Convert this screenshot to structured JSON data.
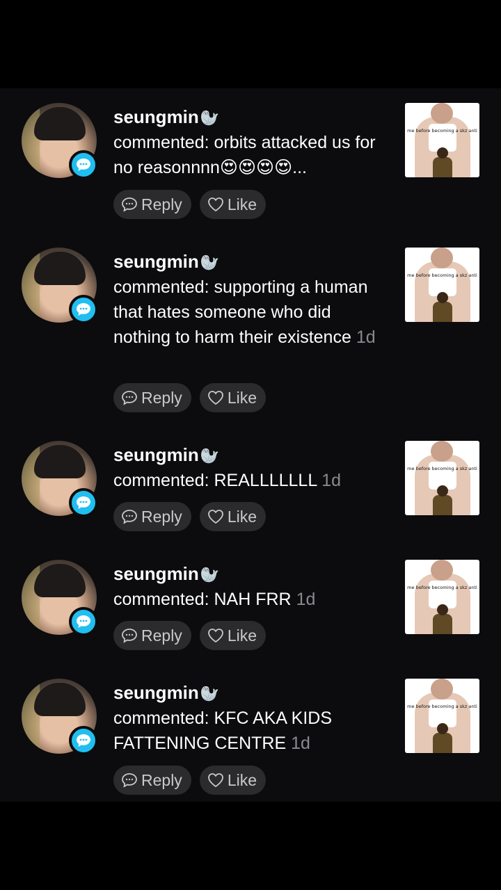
{
  "comments": [
    {
      "username": "seungmin",
      "username_emoji": "🦭",
      "text": "commented: orbits attacked us for no reasonnnn😍😍😍😍...",
      "time": "",
      "reply_label": "Reply",
      "like_label": "Like",
      "thumbnail_caption": "me before becoming a skz anti"
    },
    {
      "username": "seungmin",
      "username_emoji": "🦭",
      "text": "commented: supporting a human that hates someone who did nothing to harm their existence",
      "time": "1d",
      "reply_label": "Reply",
      "like_label": "Like",
      "thumbnail_caption": "me before becoming a skz anti"
    },
    {
      "username": "seungmin",
      "username_emoji": "🦭",
      "text": "commented: REALLLLLLL",
      "time": "1d",
      "reply_label": "Reply",
      "like_label": "Like",
      "thumbnail_caption": "me before becoming a skz anti"
    },
    {
      "username": "seungmin",
      "username_emoji": "🦭",
      "text": "commented: NAH FRR",
      "time": "1d",
      "reply_label": "Reply",
      "like_label": "Like",
      "thumbnail_caption": "me before becoming a skz anti"
    },
    {
      "username": "seungmin",
      "username_emoji": "🦭",
      "text": "commented: KFC AKA KIDS FATTENING CENTRE",
      "time": "1d",
      "reply_label": "Reply",
      "like_label": "Like",
      "thumbnail_caption": "me before becoming a skz anti"
    }
  ],
  "colors": {
    "background": "#0c0b0e",
    "badge": "#20bff0",
    "pill": "#2b2b2e",
    "timestamp": "#8a8a8e"
  },
  "icons": {
    "badge": "comment-bubble-icon",
    "reply": "reply-bubble-icon",
    "like": "heart-outline-icon"
  }
}
